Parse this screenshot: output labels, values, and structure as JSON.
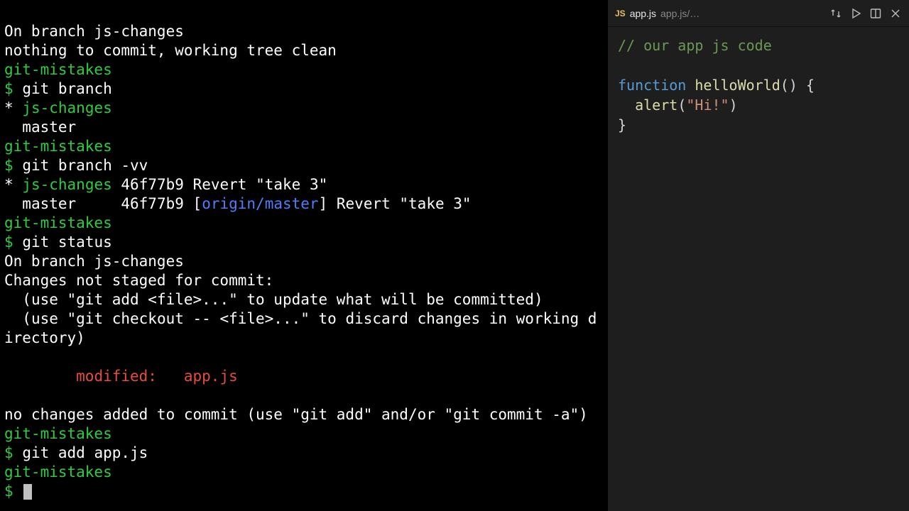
{
  "terminal": {
    "status1_line1": "On branch js-changes",
    "status1_line2": "nothing to commit, working tree clean",
    "cwd": "git-mistakes",
    "prompt": "$",
    "cmd_branch": "git branch",
    "branch_star": "*",
    "branch_current": "js-changes",
    "branch_other": "master",
    "cmd_branch_vv": "git branch -vv",
    "vv_current_hash": "46f77b9",
    "vv_current_msg": "Revert \"take 3\"",
    "vv_master_hash": "46f77b9",
    "vv_master_upstream_open": "[",
    "vv_master_upstream": "origin/master",
    "vv_master_upstream_close": "]",
    "vv_master_msg": "Revert \"take 3\"",
    "cmd_status": "git status",
    "status2_line1": "On branch js-changes",
    "status2_line2": "Changes not staged for commit:",
    "status2_hint1": "  (use \"git add <file>...\" to update what will be committed)",
    "status2_hint2": "  (use \"git checkout -- <file>...\" to discard changes in working directory)",
    "status2_modified_label": "        modified:   ",
    "status2_modified_file": "app.js",
    "status2_footer": "no changes added to commit (use \"git add\" and/or \"git commit -a\")",
    "cmd_add": "git add app.js"
  },
  "editor": {
    "tab_icon": "JS",
    "tab_filename": "app.js",
    "tab_path": "app.js/…",
    "code": {
      "l1_comment": "// our app js code",
      "l3_kw": "function",
      "l3_fn": "helloWorld",
      "l3_rest": "() {",
      "l4_indent": "  ",
      "l4_call": "alert",
      "l4_open": "(",
      "l4_str": "\"Hi!\"",
      "l4_close": ")",
      "l5": "}"
    }
  }
}
